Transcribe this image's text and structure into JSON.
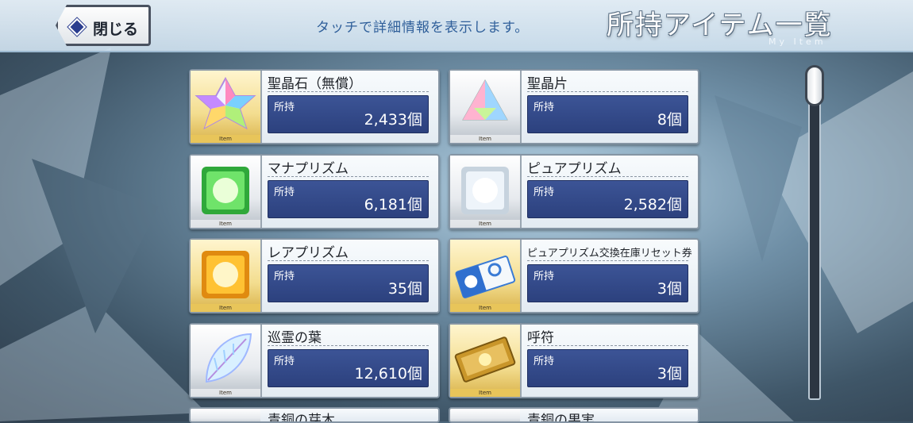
{
  "header": {
    "close_label": "閉じる",
    "hint": "タッチで詳細情報を表示します。",
    "title": "所持アイテム一覧",
    "subtitle": "My Item"
  },
  "owned_label": "所持",
  "item_badge": "Item",
  "items": [
    {
      "name": "聖晶石（無償）",
      "qty": "2,433個",
      "icon": "saint-quartz-icon"
    },
    {
      "name": "聖晶片",
      "qty": "8個",
      "icon": "quartz-fragment-icon"
    },
    {
      "name": "マナプリズム",
      "qty": "6,181個",
      "icon": "mana-prism-icon"
    },
    {
      "name": "ピュアプリズム",
      "qty": "2,582個",
      "icon": "pure-prism-icon"
    },
    {
      "name": "レアプリズム",
      "qty": "35個",
      "icon": "rare-prism-icon"
    },
    {
      "name": "ピュアプリズム交換在庫リセット券",
      "qty": "3個",
      "icon": "reset-ticket-icon"
    },
    {
      "name": "巡霊の葉",
      "qty": "12,610個",
      "icon": "spirit-leaf-icon"
    },
    {
      "name": "呼符",
      "qty": "3個",
      "icon": "summon-ticket-icon"
    }
  ],
  "peek_items": [
    {
      "name": "青銅の芽木"
    },
    {
      "name": "青銅の果実"
    }
  ],
  "colors": {
    "bar": "#2c417e",
    "accent_text": "#2f5f9a"
  }
}
